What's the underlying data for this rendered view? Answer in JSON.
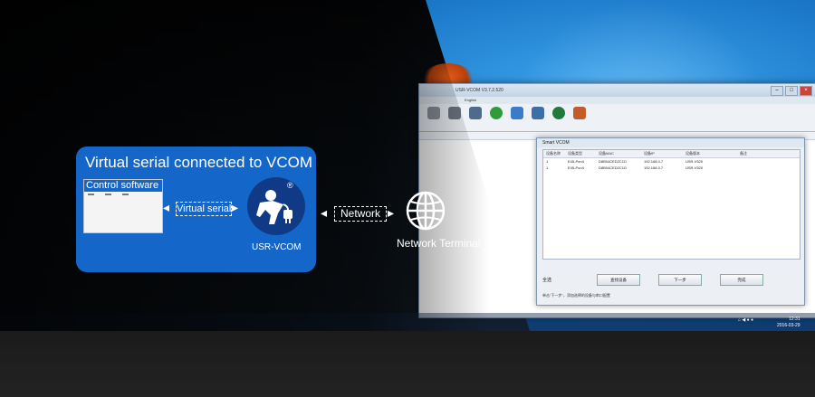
{
  "card": {
    "title": "Virtual serial connected to VCOM",
    "control_software": "Control software",
    "virtual_serial": "Virtual serial",
    "vcom_label": "USR-VCOM",
    "vcom_badge": "®"
  },
  "network": {
    "label": "Network",
    "terminal_label": "Network Terminal"
  },
  "app": {
    "title": "USR-VCOM V3.7.2.520",
    "menu": "English",
    "dialog_title": "Smart VCOM",
    "dialog_columns": [
      "设备名称",
      "设备类型",
      "设备MAC",
      "设备IP",
      "设备版本",
      "备注"
    ],
    "dialog_rows": [
      [
        "1",
        "E45-Pon4",
        "D8B04CED2C1D",
        "192.168.0.7",
        "USR-V520",
        ""
      ],
      [
        "1",
        "E45-Pon4",
        "D8B04CED2C1D",
        "192.168.0.7",
        "USR-V520",
        ""
      ]
    ],
    "select_all": "全选",
    "btn_search": "查找设备",
    "btn_next": "下一步",
    "btn_finish": "完成",
    "status_hint": "单击\"下一步\"，添加选择的设备与串口配置"
  },
  "taskbar": {
    "time": "12:31",
    "date": "2016-03-29"
  }
}
